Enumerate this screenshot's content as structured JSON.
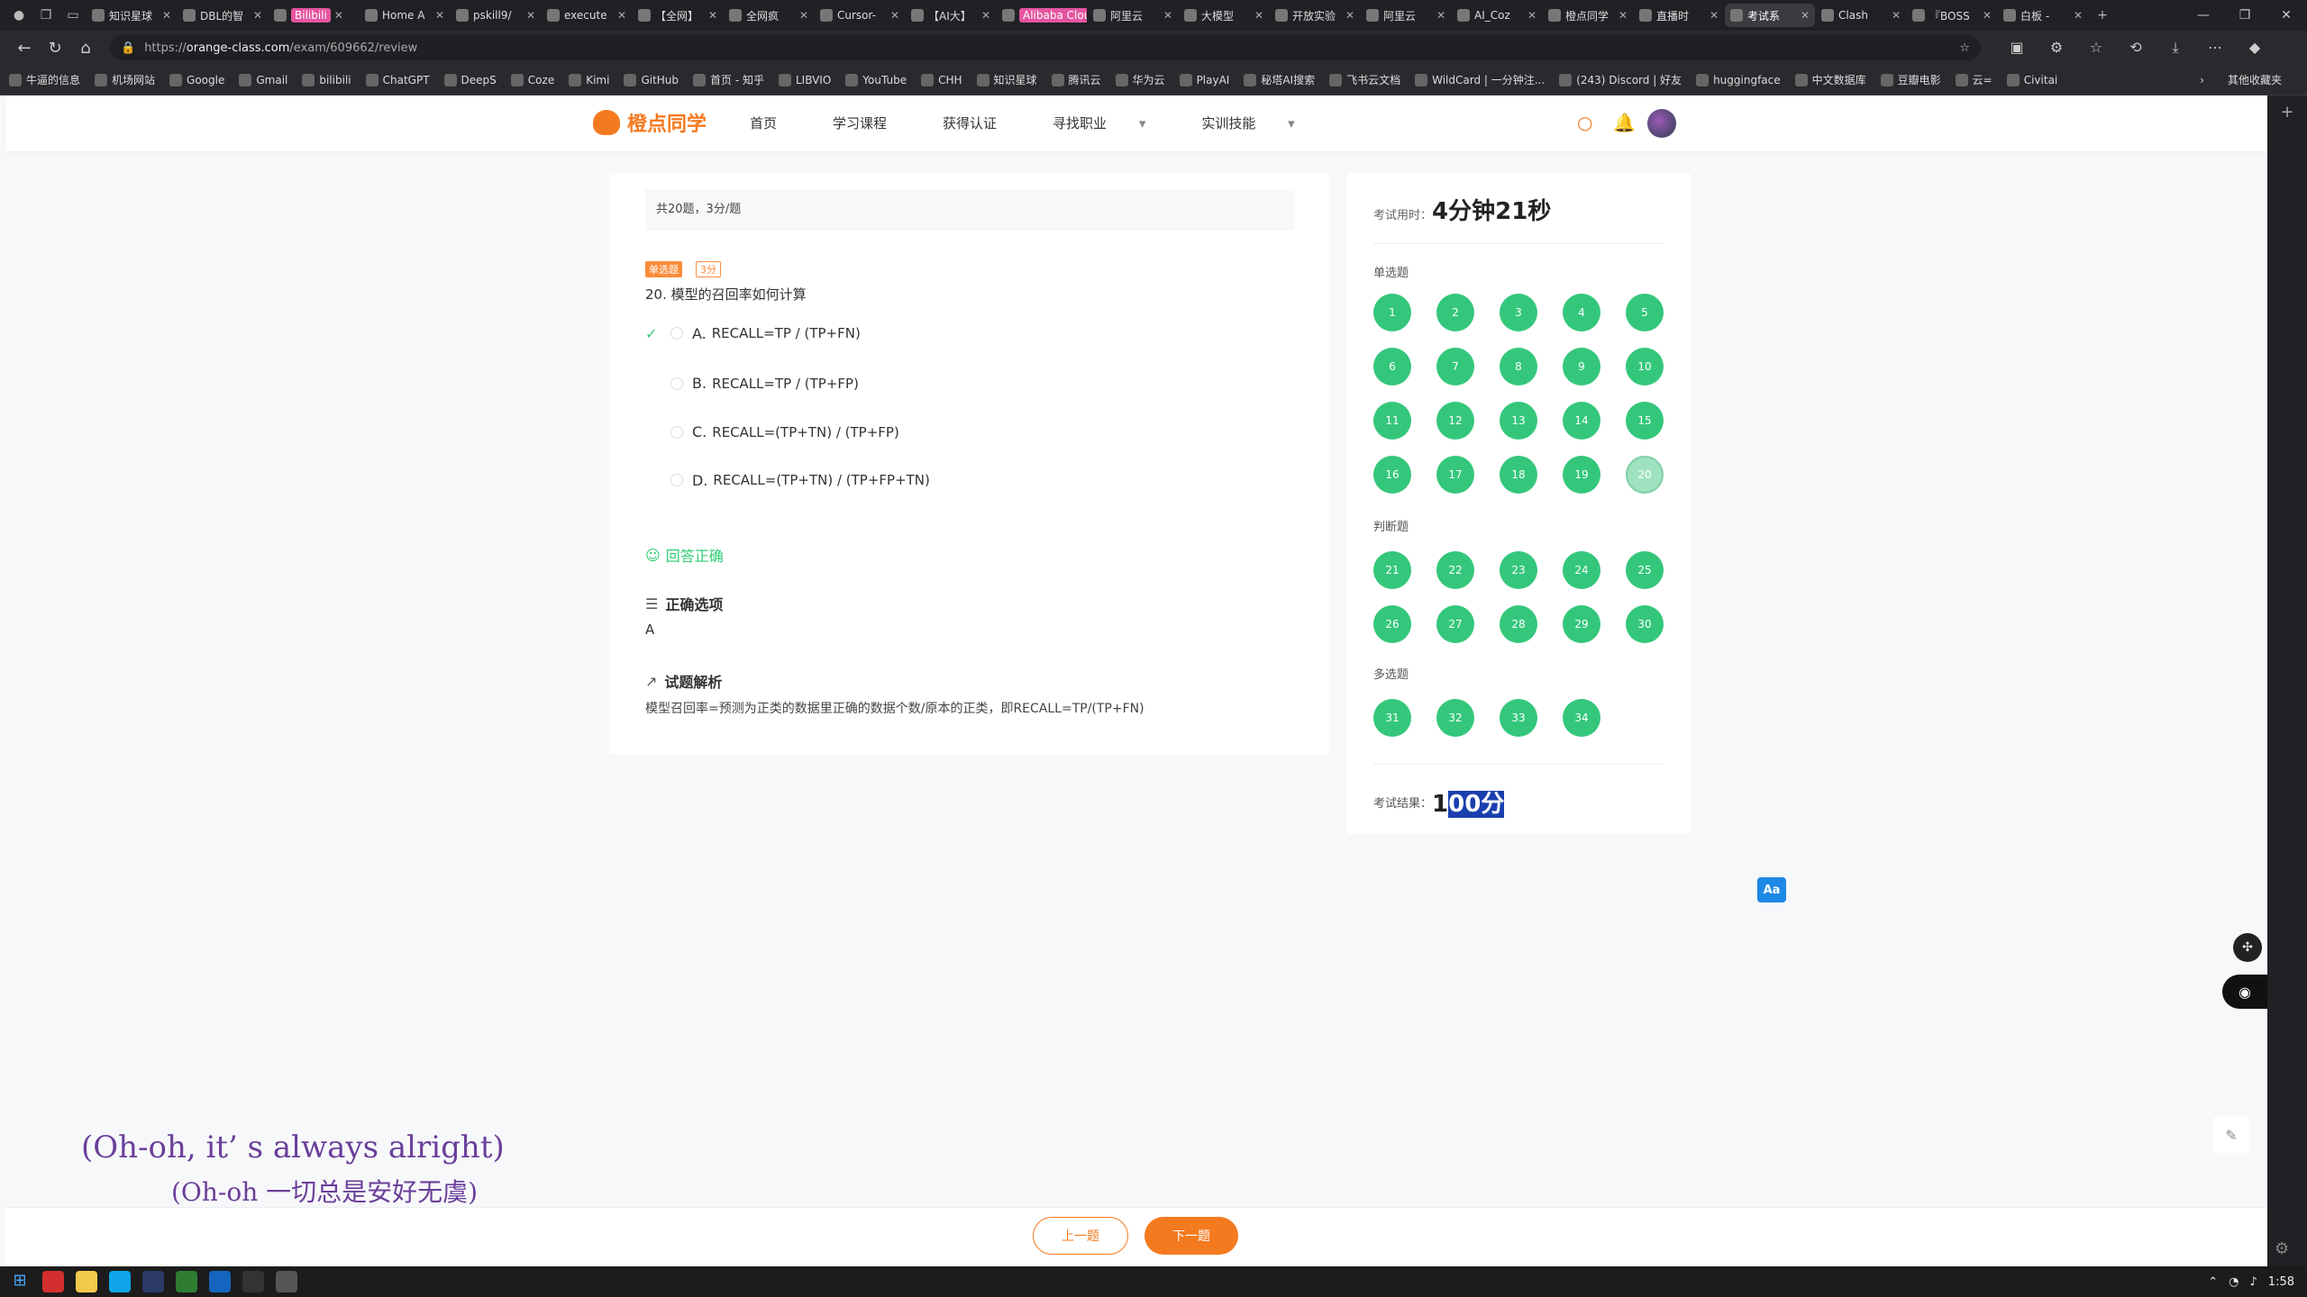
{
  "browser": {
    "tabs": [
      "知识星球",
      "DBL的智",
      "Bilibili",
      "Home A",
      "pskill9/",
      "execute",
      "【全网】",
      "全网疯",
      "Cursor-",
      "【AI大】",
      "Alibaba Cloud",
      "阿里云",
      "大模型",
      "开放实验",
      "阿里云",
      "AI_Coz",
      "橙点同学",
      "直播时",
      "考试系",
      "Clash",
      "『BOSS",
      "白板 -"
    ],
    "url_prefix": "https://",
    "url_host": "orange-class.com",
    "url_path": "/exam/609662/review",
    "bookmarks": [
      "牛逼的信息",
      "机场网站",
      "Google",
      "Gmail",
      "bilibili",
      "ChatGPT",
      "DeepS",
      "Coze",
      "Kimi",
      "GitHub",
      "首页 - 知乎",
      "LIBVIO",
      "YouTube",
      "CHH",
      "知识星球",
      "腾讯云",
      "华为云",
      "PlayAI",
      "秘塔AI搜索",
      "飞书云文档",
      "WildCard | 一分钟注...",
      "(243) Discord | 好友",
      "huggingface",
      "中文数据库",
      "豆瓣电影",
      "云=",
      " Civitai"
    ],
    "bookmarks_other": "其他收藏夹"
  },
  "site": {
    "logo": "橙点同学",
    "menu": [
      "首页",
      "学习课程",
      "获得认证",
      "寻找职业",
      "实训技能"
    ]
  },
  "question": {
    "info": "共20题，3分/题",
    "type_tag": "单选题",
    "score_tag": "3分",
    "title": "20. 模型的召回率如何计算",
    "options": [
      {
        "letter": "A.",
        "text": "RECALL=TP / (TP+FN)"
      },
      {
        "letter": "B.",
        "text": "RECALL=TP / (TP+FP)"
      },
      {
        "letter": "C.",
        "text": "RECALL=(TP+TN) / (TP+FP)"
      },
      {
        "letter": "D.",
        "text": "RECALL=(TP+TN) / (TP+FP+TN)"
      }
    ],
    "result": "回答正确",
    "correct_heading": "正确选项",
    "correct_answer": "A",
    "explain_heading": "试题解析",
    "explanation": "模型召回率=预测为正类的数据里正确的数据个数/原本的正类，即RECALL=TP/(TP+FN)"
  },
  "summary": {
    "time_label": "考试用时：",
    "time_value": "4分钟21秒",
    "single_label": "单选题",
    "single": [
      "1",
      "2",
      "3",
      "4",
      "5",
      "6",
      "7",
      "8",
      "9",
      "10",
      "11",
      "12",
      "13",
      "14",
      "15",
      "16",
      "17",
      "18",
      "19",
      "20"
    ],
    "judge_label": "判断题",
    "judge": [
      "21",
      "22",
      "23",
      "24",
      "25",
      "26",
      "27",
      "28",
      "29",
      "30"
    ],
    "multi_label": "多选题",
    "multi": [
      "31",
      "32",
      "33",
      "34"
    ],
    "score_label": "考试结果：",
    "score_first": "1",
    "score_highlight": "00分"
  },
  "floats": {
    "aa": "Aa"
  },
  "lyrics": {
    "line1": "(Oh-oh, it’ s always alright)",
    "line2": "(Oh-oh 一切总是安好无虞)"
  },
  "footer": {
    "prev": "上一题",
    "next": "下一题"
  },
  "taskbar": {
    "time": "1:58"
  }
}
